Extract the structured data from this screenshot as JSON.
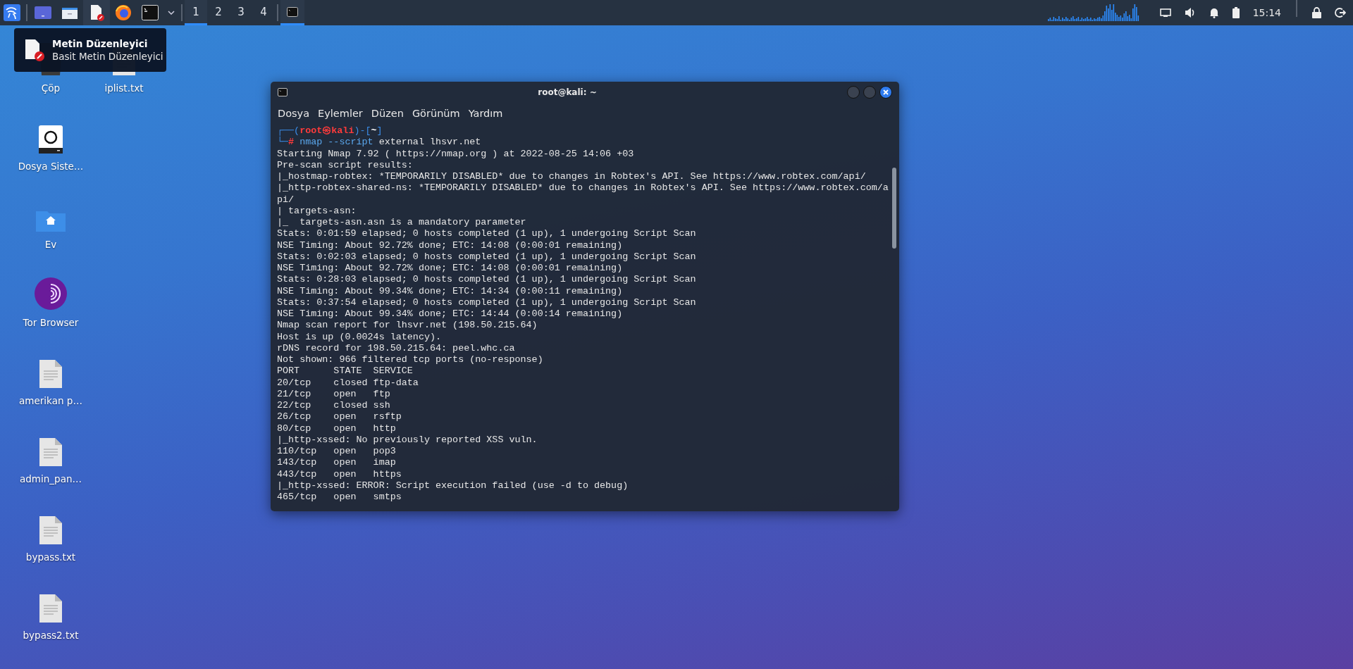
{
  "panel": {
    "launchers": [
      {
        "kind": "desktop",
        "hovered": false
      },
      {
        "kind": "files",
        "hovered": false
      },
      {
        "kind": "text-editor",
        "hovered": true
      },
      {
        "kind": "browser",
        "hovered": false
      },
      {
        "kind": "terminal",
        "hovered": false
      },
      {
        "kind": "dropdown",
        "hovered": false
      }
    ],
    "workspaces": [
      {
        "label": "1",
        "selected": true
      },
      {
        "label": "2",
        "selected": false
      },
      {
        "label": "3",
        "selected": false
      },
      {
        "label": "4",
        "selected": false
      }
    ],
    "tasks": [
      {
        "kind": "terminal",
        "selected": true
      }
    ],
    "clock": "15:14"
  },
  "tooltip": {
    "title": "Metin Düzenleyici",
    "subtitle": "Basit Metin Düzenleyici"
  },
  "desktop_icons": [
    {
      "kind": "trash",
      "label": "Çöp"
    },
    {
      "kind": "drive",
      "label": "Dosya Siste…"
    },
    {
      "kind": "home",
      "label": "Ev"
    },
    {
      "kind": "tor",
      "label": "Tor Browser"
    },
    {
      "kind": "text-file",
      "label": "amerikan p…"
    },
    {
      "kind": "text-file",
      "label": "admin_pan…"
    },
    {
      "kind": "text-file",
      "label": "bypass.txt"
    },
    {
      "kind": "text-file",
      "label": "bypass2.txt"
    },
    {
      "kind": "text-file",
      "label": "iplist.txt"
    }
  ],
  "terminal": {
    "title": "root@kali: ~",
    "menu": [
      "Dosya",
      "Eylemler",
      "Düzen",
      "Görünüm",
      "Yardım"
    ],
    "lines": [
      {
        "segments": [
          {
            "text": "┌──(",
            "kind": "frame"
          },
          {
            "text": "root㉿kali",
            "kind": "user"
          },
          {
            "text": ")-[",
            "kind": "frame"
          },
          {
            "text": "~",
            "kind": "dir"
          },
          {
            "text": "]",
            "kind": "frame"
          }
        ]
      },
      {
        "segments": [
          {
            "text": "└─",
            "kind": "frame"
          },
          {
            "text": "#",
            "kind": "user"
          },
          {
            "text": " nmap --script",
            "kind": "command"
          },
          {
            "text": " external lhsvr.net",
            "kind": "plain"
          }
        ]
      },
      {
        "text": "Starting Nmap 7.92 ( https://nmap.org ) at 2022-08-25 14:06 +03"
      },
      {
        "text": "Pre-scan script results:"
      },
      {
        "text": "|_hostmap-robtex: *TEMPORARILY DISABLED* due to changes in Robtex's API. See https://www.robtex.com/api/"
      },
      {
        "text": "|_http-robtex-shared-ns: *TEMPORARILY DISABLED* due to changes in Robtex's API. See https://www.robtex.com/a"
      },
      {
        "text": "pi/"
      },
      {
        "text": "| targets-asn:"
      },
      {
        "text": "|_  targets-asn.asn is a mandatory parameter"
      },
      {
        "text": "Stats: 0:01:59 elapsed; 0 hosts completed (1 up), 1 undergoing Script Scan"
      },
      {
        "text": "NSE Timing: About 92.72% done; ETC: 14:08 (0:00:01 remaining)"
      },
      {
        "text": "Stats: 0:02:03 elapsed; 0 hosts completed (1 up), 1 undergoing Script Scan"
      },
      {
        "text": "NSE Timing: About 92.72% done; ETC: 14:08 (0:00:01 remaining)"
      },
      {
        "text": "Stats: 0:28:03 elapsed; 0 hosts completed (1 up), 1 undergoing Script Scan"
      },
      {
        "text": "NSE Timing: About 99.34% done; ETC: 14:34 (0:00:11 remaining)"
      },
      {
        "text": "Stats: 0:37:54 elapsed; 0 hosts completed (1 up), 1 undergoing Script Scan"
      },
      {
        "text": "NSE Timing: About 99.34% done; ETC: 14:44 (0:00:14 remaining)"
      },
      {
        "text": "Nmap scan report for lhsvr.net (198.50.215.64)"
      },
      {
        "text": "Host is up (0.0024s latency)."
      },
      {
        "text": "rDNS record for 198.50.215.64: peel.whc.ca"
      },
      {
        "text": "Not shown: 966 filtered tcp ports (no-response)"
      },
      {
        "text": "PORT      STATE  SERVICE"
      },
      {
        "text": "20/tcp    closed ftp-data"
      },
      {
        "text": "21/tcp    open   ftp"
      },
      {
        "text": "22/tcp    closed ssh"
      },
      {
        "text": "26/tcp    open   rsftp"
      },
      {
        "text": "80/tcp    open   http"
      },
      {
        "text": "|_http-xssed: No previously reported XSS vuln."
      },
      {
        "text": "110/tcp   open   pop3"
      },
      {
        "text": "143/tcp   open   imap"
      },
      {
        "text": "443/tcp   open   https"
      },
      {
        "text": "|_http-xssed: ERROR: Script execution failed (use -d to debug)"
      },
      {
        "text": "465/tcp   open   smtps"
      }
    ]
  }
}
